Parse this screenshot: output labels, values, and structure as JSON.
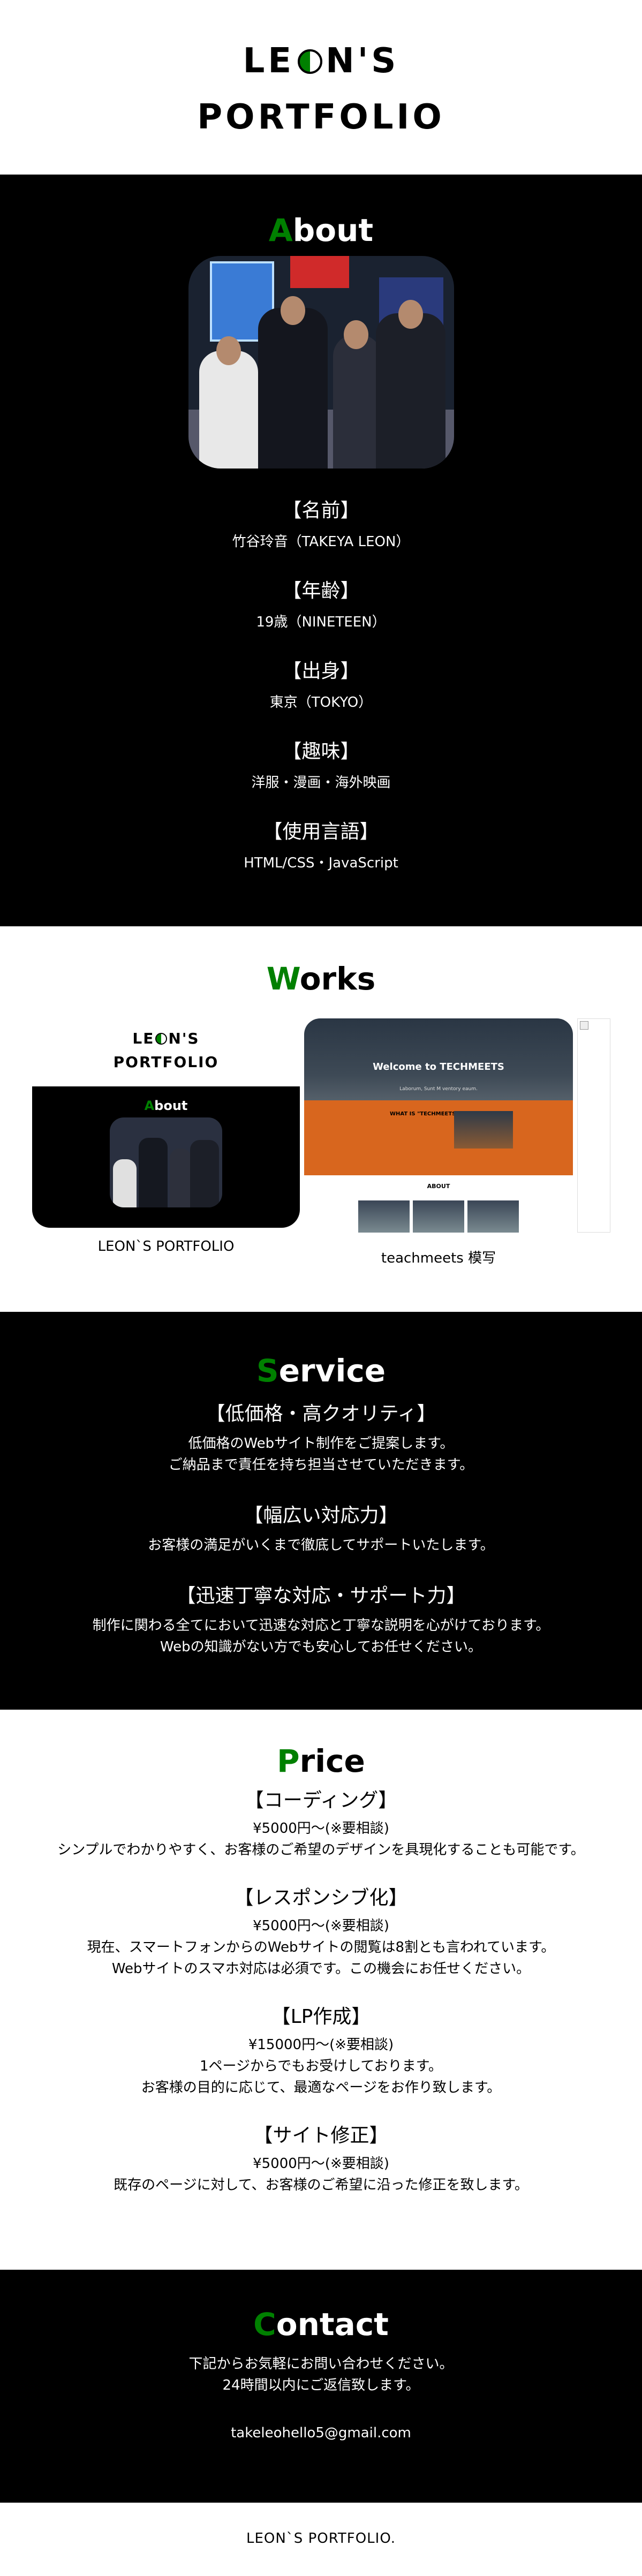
{
  "header": {
    "logo_line1_pre": "LE",
    "logo_line1_post": "N'S",
    "logo_line2": "PORTFOLIO"
  },
  "about": {
    "title_first": "A",
    "title_rest": "bout",
    "photo_alt": "",
    "items": [
      {
        "label": "【名前】",
        "value": "竹谷玲音（TAKEYA LEON）"
      },
      {
        "label": "【年齢】",
        "value": "19歳（NINETEEN）"
      },
      {
        "label": "【出身】",
        "value": "東京（TOKYO）"
      },
      {
        "label": "【趣味】",
        "value": "洋服・漫画・海外映画"
      },
      {
        "label": "【使用言語】",
        "value": "HTML/CSS・JavaScript"
      }
    ]
  },
  "works": {
    "title_first": "W",
    "title_rest": "orks",
    "items": [
      {
        "caption": "LEON`S PORTFOLIO",
        "thumb_logo_pre": "LE",
        "thumb_logo_post": "N'S",
        "thumb_logo_line2": "PORTFOLIO",
        "thumb_about_first": "A",
        "thumb_about_rest": "bout"
      },
      {
        "caption": "teachmeets 模写",
        "hero_title": "Welcome to TECHMEETS",
        "hero_sub": "Laborum, Sunt M ventory eaum.",
        "what_title": "WHAT IS \"TECHMEETS\"?",
        "about_label": "ABOUT"
      }
    ]
  },
  "service": {
    "title_first": "S",
    "title_rest": "ervice",
    "items": [
      {
        "heading": "【低価格・高クオリティ】",
        "lines": [
          "低価格のWebサイト制作をご提案します。",
          "ご納品まで責任を持ち担当させていただきます。"
        ]
      },
      {
        "heading": "【幅広い対応力】",
        "lines": [
          "お客様の満足がいくまで徹底してサポートいたします。"
        ]
      },
      {
        "heading": "【迅速丁寧な対応・サポート力】",
        "lines": [
          "制作に関わる全てにおいて迅速な対応と丁寧な説明を心がけております。",
          "Webの知識がない方でも安心してお任せください。"
        ]
      }
    ]
  },
  "price": {
    "title_first": "P",
    "title_rest": "rice",
    "items": [
      {
        "heading": "【コーディング】",
        "amount": "¥5000円～(※要相談)",
        "lines": [
          "シンプルでわかりやすく、お客様のご希望のデザインを具現化することも可能です。"
        ]
      },
      {
        "heading": "【レスポンシブ化】",
        "amount": "¥5000円～(※要相談)",
        "lines": [
          "現在、スマートフォンからのWebサイトの閲覧は8割とも言われています。",
          "Webサイトのスマホ対応は必須です。この機会にお任せください。"
        ]
      },
      {
        "heading": "【LP作成】",
        "amount": "¥15000円～(※要相談)",
        "lines": [
          "1ページからでもお受けしております。",
          "お客様の目的に応じて、最適なページをお作り致します。"
        ]
      },
      {
        "heading": "【サイト修正】",
        "amount": "¥5000円～(※要相談)",
        "lines": [
          "既存のページに対して、お客様のご希望に沿った修正を致します。"
        ]
      }
    ]
  },
  "contact": {
    "title_first": "C",
    "title_rest": "ontact",
    "lines": [
      "下記からお気軽にお問い合わせください。",
      "24時間以内にご返信致します。"
    ],
    "email": "takeleohello5@gmail.com"
  },
  "footer": {
    "text": "LEON`S PORTFOLIO."
  },
  "colors": {
    "accent": "#008000",
    "dark": "#000000",
    "light": "#ffffff"
  }
}
